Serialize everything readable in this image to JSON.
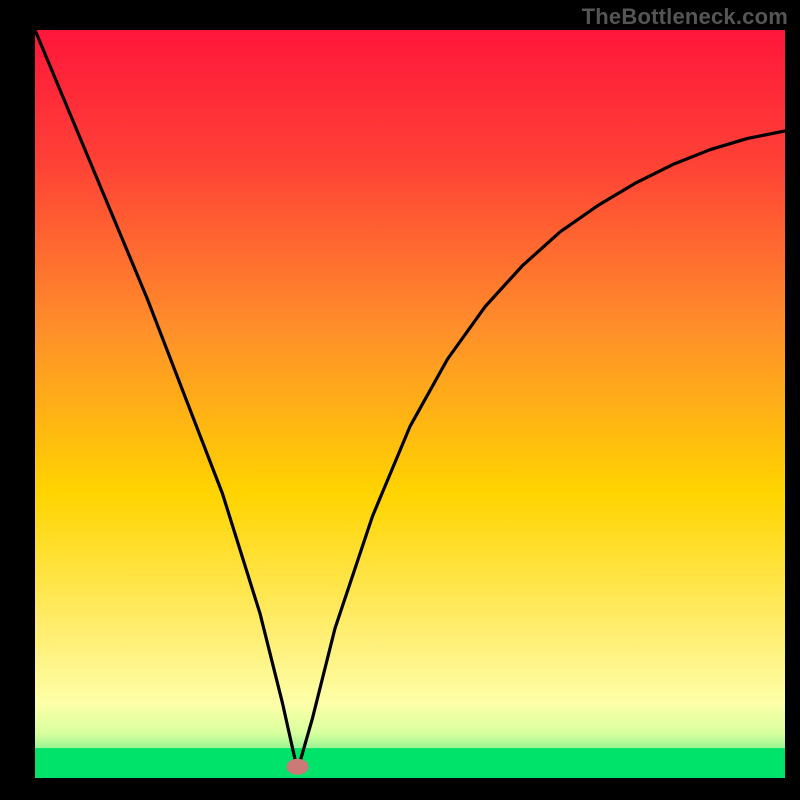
{
  "watermark": "TheBottleneck.com",
  "chart_data": {
    "type": "line",
    "title": "",
    "xlabel": "",
    "ylabel": "",
    "xlim": [
      0,
      100
    ],
    "ylim": [
      0,
      100
    ],
    "background_gradient": {
      "top": "#ff183b",
      "middle": "#ffd400",
      "bottom": "#00e36b"
    },
    "green_band": {
      "y_from": 0,
      "y_to": 4
    },
    "marker": {
      "x": 35,
      "y": 1.5,
      "color": "#cc7a77"
    },
    "series": [
      {
        "name": "curve",
        "x": [
          0,
          5,
          10,
          15,
          20,
          25,
          30,
          33,
          35,
          37,
          40,
          45,
          50,
          55,
          60,
          65,
          70,
          75,
          80,
          85,
          90,
          95,
          100
        ],
        "values": [
          100,
          88,
          76,
          64,
          51,
          38,
          22,
          10,
          1,
          8,
          20,
          35,
          47,
          56,
          63,
          68.5,
          73,
          76.5,
          79.5,
          82,
          84,
          85.5,
          86.5
        ]
      }
    ]
  }
}
